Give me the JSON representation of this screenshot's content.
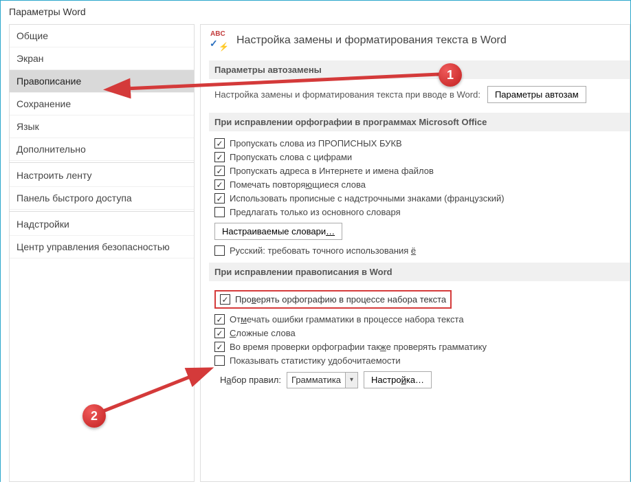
{
  "window": {
    "title": "Параметры Word"
  },
  "sidebar": {
    "items": [
      {
        "label": "Общие"
      },
      {
        "label": "Экран"
      },
      {
        "label": "Правописание",
        "selected": true
      },
      {
        "label": "Сохранение"
      },
      {
        "label": "Язык"
      },
      {
        "label": "Дополнительно"
      },
      {
        "label": "Настроить ленту"
      },
      {
        "label": "Панель быстрого доступа"
      },
      {
        "label": "Надстройки"
      },
      {
        "label": "Центр управления безопасностью"
      }
    ]
  },
  "heading": {
    "title": "Настройка замены и форматирования текста в Word"
  },
  "section_autocorrect": {
    "title": "Параметры автозамены",
    "label": "Настройка замены и форматирования текста при вводе в Word:",
    "button": "Параметры автозам"
  },
  "section_spell_office": {
    "title": "При исправлении орфографии в программах Microsoft Office",
    "opts": [
      {
        "checked": true,
        "html": "Пропускать слова из ПРОПИСНЫХ БУКВ"
      },
      {
        "checked": true,
        "html": "Пропускать слова с цифрами"
      },
      {
        "checked": true,
        "html": "Пропускать адреса в Интернете и имена файлов"
      },
      {
        "checked": true,
        "html": "Помечать повторя<u>ю</u>щиеся слова"
      },
      {
        "checked": true,
        "html": "Использовать прописные с надстрочными знаками (французский)"
      },
      {
        "checked": false,
        "html": "Предлагать только из основного словаря"
      }
    ],
    "dict_button": "Настраиваемые словари<u>…</u>",
    "extra": {
      "checked": false,
      "html": "Русский: требовать точного использования <u>ё</u>"
    }
  },
  "section_spell_word": {
    "title": "При исправлении правописания в Word",
    "opts": [
      {
        "checked": true,
        "highlight": true,
        "html": "Про<u>в</u>ерять орфографию в процессе набора текста"
      },
      {
        "checked": true,
        "html": "От<u>м</u>ечать ошибки грамматики в процессе набора текста"
      },
      {
        "checked": true,
        "html": "<u>С</u>ложные слова"
      },
      {
        "checked": true,
        "html": "Во время проверки орфографии так<u>ж</u>е проверять грамматику"
      },
      {
        "checked": false,
        "html": "Показывать статистику <u>у</u>добочитаемости"
      }
    ],
    "ruleset": {
      "label": "Н<u>а</u>бор правил:",
      "value": "Грамматика",
      "button": "Настро<u>й</u>ка…"
    }
  },
  "badges": {
    "b1": "1",
    "b2": "2"
  }
}
